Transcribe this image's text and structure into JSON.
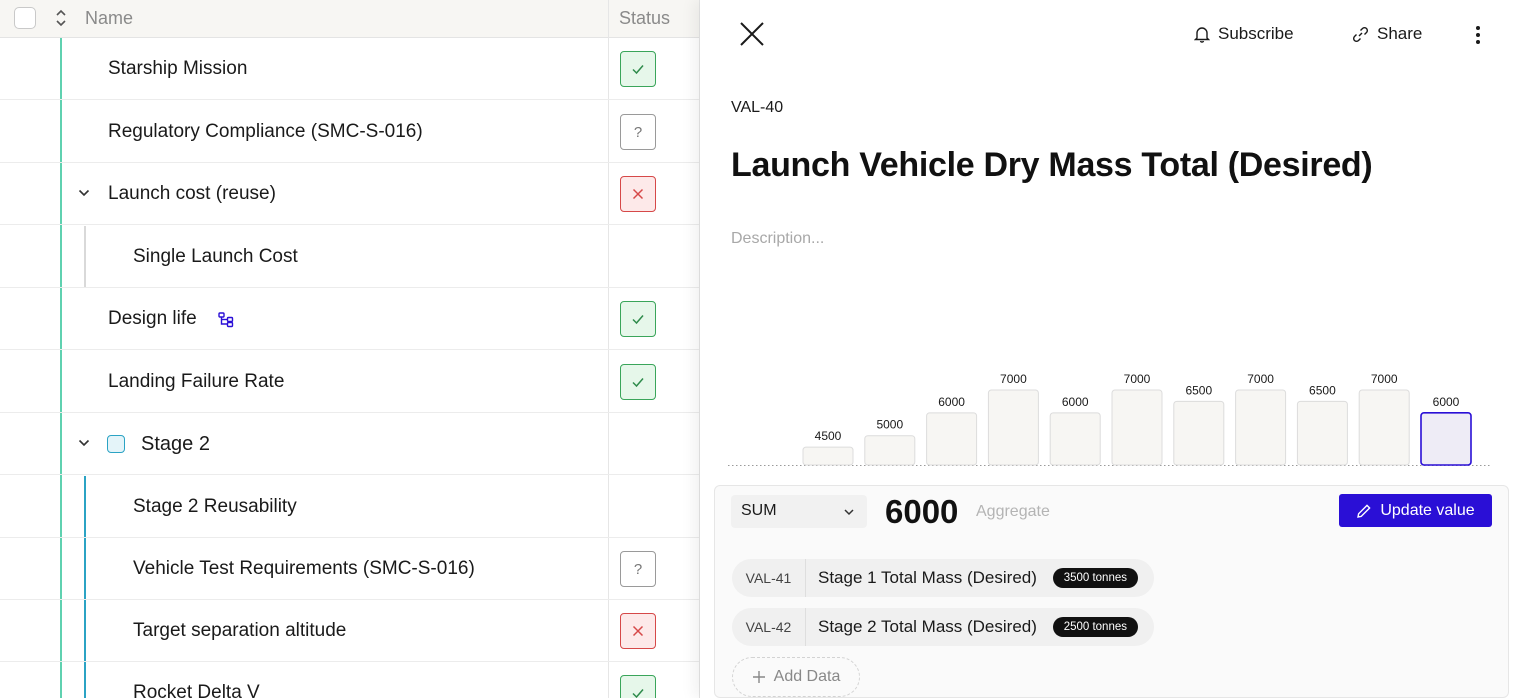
{
  "table": {
    "header": {
      "name": "Name",
      "status": "Status"
    },
    "rows": [
      {
        "label": "Starship Mission",
        "status": "ok"
      },
      {
        "label": "Regulatory Compliance (SMC-S-016)",
        "status": "unknown",
        "status_glyph": "?"
      },
      {
        "label": "Launch cost (reuse)",
        "status": "bad"
      },
      {
        "label": "Single Launch Cost",
        "status": "none"
      },
      {
        "label": "Design life",
        "status": "ok"
      },
      {
        "label": "Landing Failure Rate",
        "status": "ok"
      },
      {
        "label": "Stage 2",
        "status": "none"
      },
      {
        "label": "Stage 2 Reusability",
        "status": "none"
      },
      {
        "label": "Vehicle Test Requirements (SMC-S-016)",
        "status": "unknown",
        "status_glyph": "?"
      },
      {
        "label": "Target separation altitude",
        "status": "bad"
      },
      {
        "label": "Rocket Delta V",
        "status": "ok"
      }
    ]
  },
  "panel": {
    "subscribe": "Subscribe",
    "share": "Share",
    "id": "VAL-40",
    "title": "Launch Vehicle Dry Mass Total (Desired)",
    "description_placeholder": "Description...",
    "aggregate": {
      "function": "SUM",
      "value": "6000",
      "label": "Aggregate",
      "update_button": "Update value"
    },
    "linked": [
      {
        "id": "VAL-41",
        "name": "Stage 1 Total Mass (Desired)",
        "value": "3500 tonnes"
      },
      {
        "id": "VAL-42",
        "name": "Stage 2 Total Mass (Desired)",
        "value": "2500 tonnes"
      }
    ],
    "add_data": "Add Data"
  },
  "colors": {
    "accent": "#2a0fd6",
    "ok_border": "#3aa55a",
    "bad_border": "#d64848",
    "tree_line": "#5fd1b0",
    "tree_line_stage2": "#2ba3c4"
  },
  "chart_data": {
    "type": "bar",
    "values": [
      4500,
      5000,
      6000,
      7000,
      6000,
      7000,
      6500,
      7000,
      6500,
      7000,
      6000
    ],
    "labels": [
      "4500",
      "5000",
      "6000",
      "7000",
      "6000",
      "7000",
      "6500",
      "7000",
      "6500",
      "7000",
      "6000"
    ],
    "highlight_index": 10,
    "grid": false
  }
}
